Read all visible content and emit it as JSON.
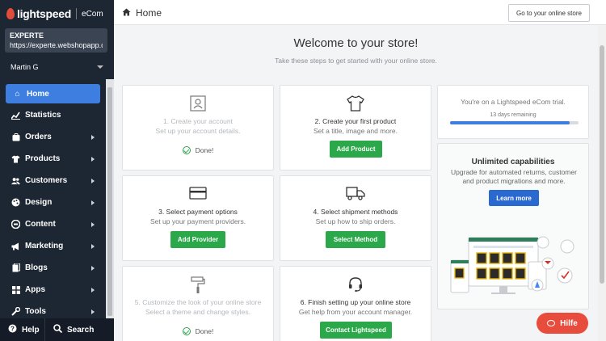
{
  "sidebar": {
    "brand": "lightspeed",
    "product": "eCom",
    "store_name": "EXPERTE",
    "store_url": "https://experte.webshopapp.c...",
    "user": "Martin G",
    "items": [
      {
        "label": "Home",
        "icon": "home-icon",
        "active": true
      },
      {
        "label": "Statistics",
        "icon": "chart-icon"
      },
      {
        "label": "Orders",
        "icon": "orders-icon"
      },
      {
        "label": "Products",
        "icon": "tshirt-icon"
      },
      {
        "label": "Customers",
        "icon": "users-icon"
      },
      {
        "label": "Design",
        "icon": "palette-icon"
      },
      {
        "label": "Content",
        "icon": "content-icon"
      },
      {
        "label": "Marketing",
        "icon": "megaphone-icon"
      },
      {
        "label": "Blogs",
        "icon": "blogs-icon"
      },
      {
        "label": "Apps",
        "icon": "apps-icon"
      },
      {
        "label": "Tools",
        "icon": "tools-icon"
      }
    ],
    "help_label": "Help",
    "search_label": "Search"
  },
  "header": {
    "title": "Home",
    "goto_label": "Go to your online store"
  },
  "main": {
    "welcome": "Welcome to your store!",
    "subtitle": "Take these steps to get started with your online store.",
    "cards": [
      {
        "title": "1. Create your account",
        "subtitle": "Set up your account details.",
        "status": "Done!"
      },
      {
        "title": "2. Create your first product",
        "subtitle": "Set a title, image and more.",
        "button": "Add Product"
      },
      {
        "title": "3. Select payment options",
        "subtitle": "Set up your payment providers.",
        "button": "Add Provider"
      },
      {
        "title": "4. Select shipment methods",
        "subtitle": "Set up how to ship orders.",
        "button": "Select Method"
      },
      {
        "title": "5. Customize the look of your online store",
        "subtitle": "Select a theme and change styles.",
        "status": "Done!"
      },
      {
        "title": "6. Finish setting up your online store",
        "subtitle": "Get help from your account manager.",
        "button": "Contact Lightspeed"
      }
    ],
    "trial": {
      "text": "You're on a Lightspeed eCom trial.",
      "remaining": "13 days remaining",
      "progress": 0.93
    },
    "upgrade": {
      "title": "Unlimited capabilities",
      "text": "Upgrade for automated returns, customer and product migrations and more.",
      "button": "Learn more"
    }
  },
  "chat": {
    "label": "Hilfe"
  },
  "colors": {
    "accent": "#3e7ee0",
    "success": "#2aa84a",
    "sidebar": "#1d2633",
    "chat": "#e74c3c"
  }
}
